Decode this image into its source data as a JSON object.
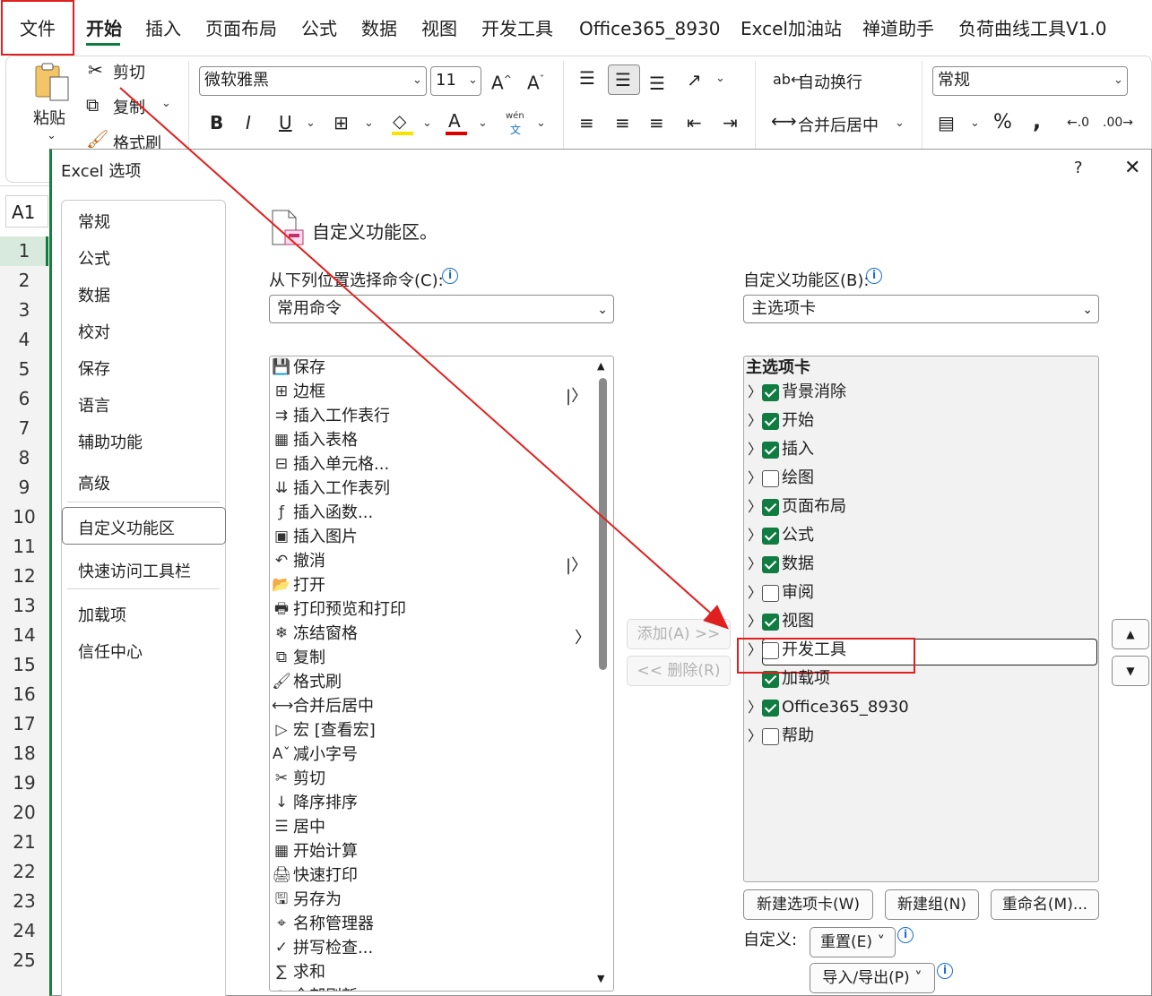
{
  "menubar": {
    "items": [
      "文件",
      "开始",
      "插入",
      "页面布局",
      "公式",
      "数据",
      "视图",
      "开发工具",
      "Office365_8930",
      "Excel加油站",
      "禅道助手",
      "负荷曲线工具V1.0"
    ]
  },
  "ribbon": {
    "paste": "粘贴",
    "cut": "剪切",
    "copy": "复制",
    "format_painter": "格式刷",
    "font_name": "微软雅黑",
    "font_size": "11",
    "wrap_text": "自动换行",
    "merge_center": "合并后居中",
    "number_format": "常规",
    "bold": "B",
    "italic": "I",
    "underline": "U",
    "wen": "wén",
    "wen_sub": "文"
  },
  "namebox": "A1",
  "rows": [
    "1",
    "2",
    "3",
    "4",
    "5",
    "6",
    "7",
    "8",
    "9",
    "10",
    "11",
    "12",
    "13",
    "14",
    "15",
    "16",
    "17",
    "18",
    "19",
    "20",
    "21",
    "22",
    "23",
    "24",
    "25"
  ],
  "dialog": {
    "title": "Excel 选项",
    "help": "?",
    "close": "✕",
    "nav": [
      "常规",
      "公式",
      "数据",
      "校对",
      "保存",
      "语言",
      "辅助功能",
      "高级",
      "自定义功能区",
      "快速访问工具栏",
      "加载项",
      "信任中心"
    ],
    "heading": "自定义功能区。",
    "choose_label": "从下列位置选择命令(C):",
    "choose_value": "常用命令",
    "customize_label": "自定义功能区(B):",
    "customize_value": "主选项卡",
    "commands": [
      "保存",
      "边框",
      "插入工作表行",
      "插入表格",
      "插入单元格...",
      "插入工作表列",
      "插入函数...",
      "插入图片",
      "撤消",
      "打开",
      "打印预览和打印",
      "冻结窗格",
      "复制",
      "格式刷",
      "合并后居中",
      "宏 [查看宏]",
      "减小字号",
      "剪切",
      "降序排序",
      "居中",
      "开始计算",
      "快速打印",
      "另存为",
      "名称管理器",
      "拼写检查...",
      "求和",
      "全部刷新"
    ],
    "tree_header": "主选项卡",
    "tree": [
      {
        "label": "背景消除",
        "checked": true
      },
      {
        "label": "开始",
        "checked": true
      },
      {
        "label": "插入",
        "checked": true
      },
      {
        "label": "绘图",
        "checked": false
      },
      {
        "label": "页面布局",
        "checked": true
      },
      {
        "label": "公式",
        "checked": true
      },
      {
        "label": "数据",
        "checked": true
      },
      {
        "label": "审阅",
        "checked": false
      },
      {
        "label": "视图",
        "checked": true
      },
      {
        "label": "开发工具",
        "checked": false
      },
      {
        "label": "加载项",
        "checked": true
      },
      {
        "label": "Office365_8930",
        "checked": true
      },
      {
        "label": "帮助",
        "checked": false
      }
    ],
    "add_button": "添加(A) >>",
    "remove_button": "<< 删除(R)",
    "new_tab": "新建选项卡(W)",
    "new_group": "新建组(N)",
    "rename": "重命名(M)...",
    "customizations": "自定义:",
    "reset": "重置(E) ˅",
    "import_export": "导入/导出(P) ˅"
  },
  "colors": {
    "accent": "#107c41",
    "annotation": "#e02020",
    "info": "#1a6fd1"
  }
}
